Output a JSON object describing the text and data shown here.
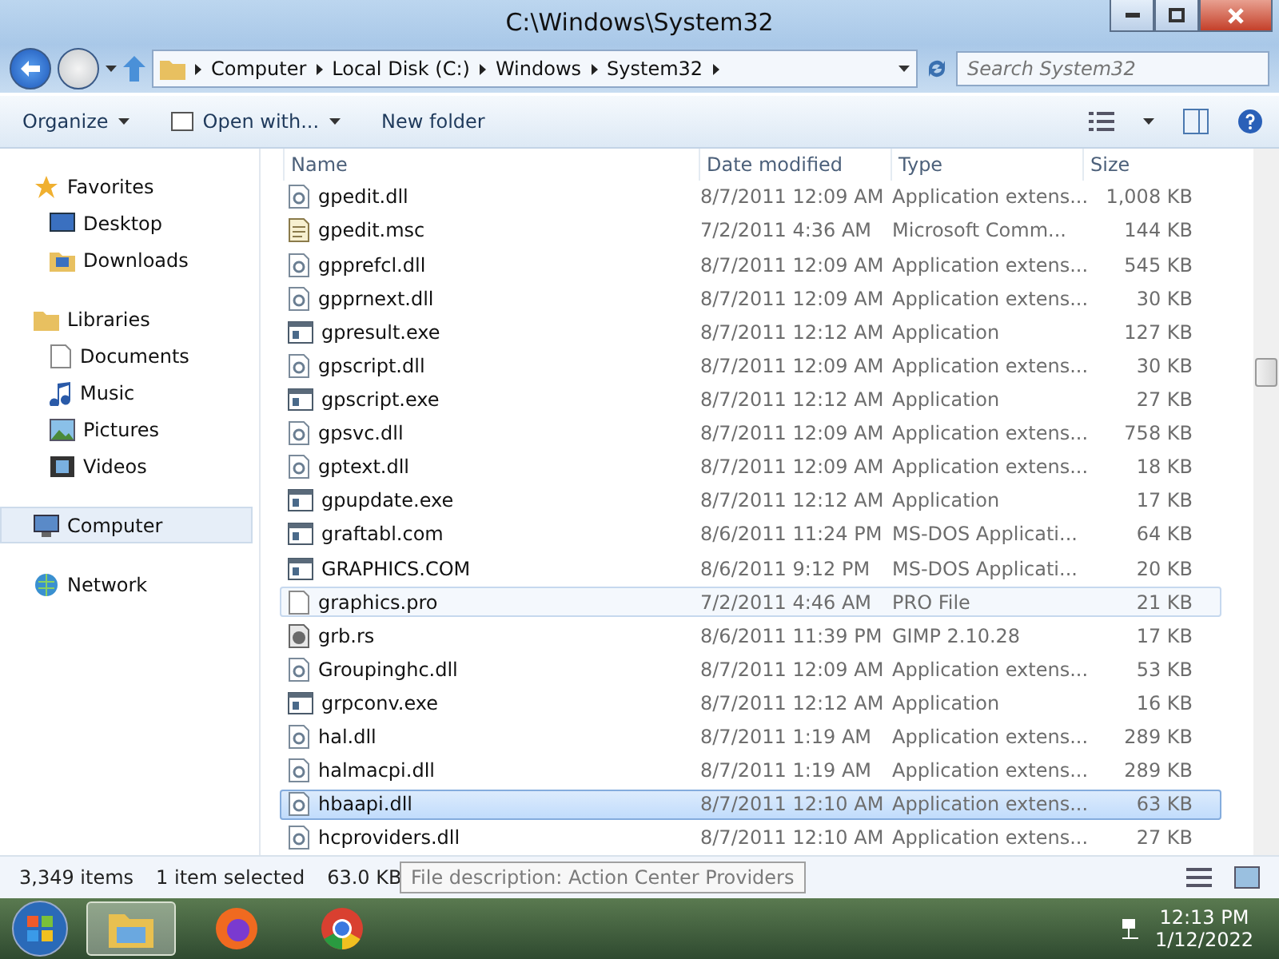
{
  "window": {
    "title": "C:\\Windows\\System32"
  },
  "address": {
    "crumbs": [
      "Computer",
      "Local Disk (C:)",
      "Windows",
      "System32"
    ],
    "search_placeholder": "Search System32"
  },
  "toolbar": {
    "buttons": [
      {
        "label": "Organize",
        "kind": "menu"
      },
      {
        "label": "Open with...",
        "kind": "openwith"
      },
      {
        "label": "New folder",
        "kind": "plain"
      }
    ]
  },
  "sidebar": {
    "groups": [
      {
        "label": "Favorites",
        "kind": "star",
        "selected": false,
        "children": [
          {
            "label": "Desktop",
            "kind": "desktop",
            "selected": false
          },
          {
            "label": "Downloads",
            "kind": "folder",
            "selected": false
          }
        ]
      },
      {
        "label": "Libraries",
        "kind": "library",
        "selected": false,
        "children": [
          {
            "label": "Documents",
            "kind": "doc",
            "selected": false
          },
          {
            "label": "Music",
            "kind": "music",
            "selected": false
          },
          {
            "label": "Pictures",
            "kind": "picture",
            "selected": false
          },
          {
            "label": "Videos",
            "kind": "video",
            "selected": false
          }
        ]
      },
      {
        "label": "Computer",
        "kind": "computer",
        "selected": true
      },
      {
        "label": "Network",
        "kind": "network",
        "selected": false
      }
    ]
  },
  "table": {
    "columns": [
      "Name",
      "Date modified",
      "Type",
      "Size"
    ],
    "rows": [
      {
        "name": "gpedit.dll",
        "date": "8/7/2011 12:09 AM",
        "type": "Application extens...",
        "size": "1,008 KB",
        "kind": "dll",
        "selected": false,
        "hovered": false
      },
      {
        "name": "gpedit.msc",
        "date": "7/2/2011 4:36 AM",
        "type": "Microsoft Comm...",
        "size": "144 KB",
        "kind": "msc",
        "selected": false,
        "hovered": false
      },
      {
        "name": "gpprefcl.dll",
        "date": "8/7/2011 12:09 AM",
        "type": "Application extens...",
        "size": "545 KB",
        "kind": "dll",
        "selected": false,
        "hovered": false
      },
      {
        "name": "gpprnext.dll",
        "date": "8/7/2011 12:09 AM",
        "type": "Application extens...",
        "size": "30 KB",
        "kind": "dll",
        "selected": false,
        "hovered": false
      },
      {
        "name": "gpresult.exe",
        "date": "8/7/2011 12:12 AM",
        "type": "Application",
        "size": "127 KB",
        "kind": "exe",
        "selected": false,
        "hovered": false
      },
      {
        "name": "gpscript.dll",
        "date": "8/7/2011 12:09 AM",
        "type": "Application extens...",
        "size": "30 KB",
        "kind": "dll",
        "selected": false,
        "hovered": false
      },
      {
        "name": "gpscript.exe",
        "date": "8/7/2011 12:12 AM",
        "type": "Application",
        "size": "27 KB",
        "kind": "exe",
        "selected": false,
        "hovered": false
      },
      {
        "name": "gpsvc.dll",
        "date": "8/7/2011 12:09 AM",
        "type": "Application extens...",
        "size": "758 KB",
        "kind": "dll",
        "selected": false,
        "hovered": false
      },
      {
        "name": "gptext.dll",
        "date": "8/7/2011 12:09 AM",
        "type": "Application extens...",
        "size": "18 KB",
        "kind": "dll",
        "selected": false,
        "hovered": false
      },
      {
        "name": "gpupdate.exe",
        "date": "8/7/2011 12:12 AM",
        "type": "Application",
        "size": "17 KB",
        "kind": "exe",
        "selected": false,
        "hovered": false
      },
      {
        "name": "graftabl.com",
        "date": "8/6/2011 11:24 PM",
        "type": "MS-DOS Applicati...",
        "size": "64 KB",
        "kind": "exe",
        "selected": false,
        "hovered": false
      },
      {
        "name": "GRAPHICS.COM",
        "date": "8/6/2011 9:12 PM",
        "type": "MS-DOS Applicati...",
        "size": "20 KB",
        "kind": "exe",
        "selected": false,
        "hovered": false
      },
      {
        "name": "graphics.pro",
        "date": "7/2/2011 4:46 AM",
        "type": "PRO File",
        "size": "21 KB",
        "kind": "blank",
        "selected": false,
        "hovered": true
      },
      {
        "name": "grb.rs",
        "date": "8/6/2011 11:39 PM",
        "type": "GIMP 2.10.28",
        "size": "17 KB",
        "kind": "image",
        "selected": false,
        "hovered": false
      },
      {
        "name": "Groupinghc.dll",
        "date": "8/7/2011 12:09 AM",
        "type": "Application extens...",
        "size": "53 KB",
        "kind": "dll",
        "selected": false,
        "hovered": false
      },
      {
        "name": "grpconv.exe",
        "date": "8/7/2011 12:12 AM",
        "type": "Application",
        "size": "16 KB",
        "kind": "exe",
        "selected": false,
        "hovered": false
      },
      {
        "name": "hal.dll",
        "date": "8/7/2011 1:19 AM",
        "type": "Application extens...",
        "size": "289 KB",
        "kind": "dll",
        "selected": false,
        "hovered": false
      },
      {
        "name": "halmacpi.dll",
        "date": "8/7/2011 1:19 AM",
        "type": "Application extens...",
        "size": "289 KB",
        "kind": "dll",
        "selected": false,
        "hovered": false
      },
      {
        "name": "hbaapi.dll",
        "date": "8/7/2011 12:10 AM",
        "type": "Application extens...",
        "size": "63 KB",
        "kind": "dll",
        "selected": true,
        "hovered": false
      },
      {
        "name": "hcproviders.dll",
        "date": "8/7/2011 12:10 AM",
        "type": "Application extens...",
        "size": "27 KB",
        "kind": "dll",
        "selected": false,
        "hovered": false
      }
    ]
  },
  "status_bar": {
    "items": "3,349 items",
    "selection": "1 item selected",
    "size": "63.0 KB"
  },
  "tooltip": "File description: Action Center Providers",
  "taskbar": {
    "apps": [
      {
        "kind": "explorer",
        "selected": true
      },
      {
        "kind": "firefox",
        "selected": false
      },
      {
        "kind": "chrome",
        "selected": false
      }
    ],
    "time": "12:13 PM",
    "date": "1/12/2022"
  }
}
